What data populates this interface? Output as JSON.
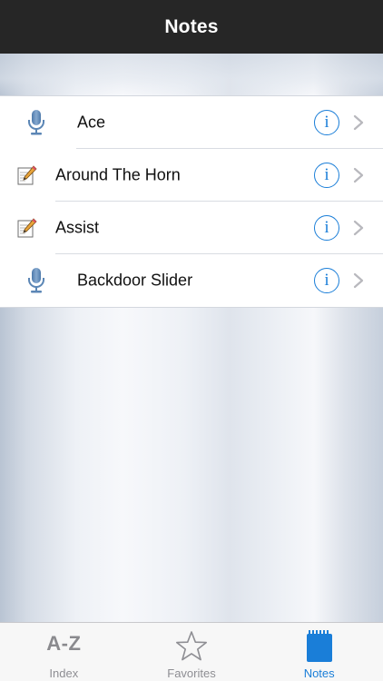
{
  "navbar": {
    "title": "Notes"
  },
  "rows": [
    {
      "label": "Ace",
      "icon": "microphone-icon"
    },
    {
      "label": "Around The Horn",
      "icon": "note-pencil-icon"
    },
    {
      "label": "Assist",
      "icon": "note-pencil-icon"
    },
    {
      "label": "Backdoor Slider",
      "icon": "microphone-icon"
    }
  ],
  "tabbar": {
    "index": {
      "icon_text": "A-Z",
      "label": "Index"
    },
    "favorites": {
      "label": "Favorites",
      "icon": "star-icon"
    },
    "notes": {
      "label": "Notes",
      "icon": "notepad-icon"
    }
  },
  "colors": {
    "accent": "#1a7ed8",
    "navbar_bg": "#262626",
    "tab_inactive": "#8e8e93",
    "mic_blue": "#5b86b5"
  }
}
